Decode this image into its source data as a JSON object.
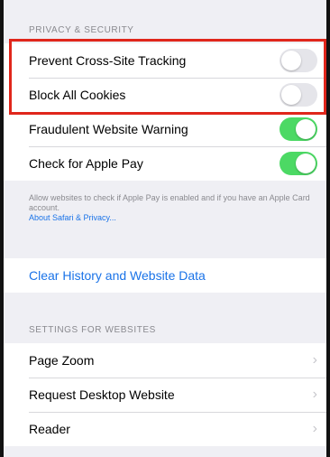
{
  "privacy_section": {
    "header": "PRIVACY & SECURITY",
    "rows": [
      {
        "label": "Prevent Cross-Site Tracking",
        "toggle": "off"
      },
      {
        "label": "Block All Cookies",
        "toggle": "off"
      },
      {
        "label": "Fraudulent Website Warning",
        "toggle": "on"
      },
      {
        "label": "Check for Apple Pay",
        "toggle": "on"
      }
    ],
    "footer": "Allow websites to check if Apple Pay is enabled and if you have an Apple Card account.",
    "footer_link": "About Safari & Privacy..."
  },
  "clear_history": {
    "label": "Clear History and Website Data"
  },
  "websites_section": {
    "header": "SETTINGS FOR WEBSITES",
    "rows": [
      {
        "label": "Page Zoom"
      },
      {
        "label": "Request Desktop Website"
      },
      {
        "label": "Reader"
      }
    ]
  },
  "colors": {
    "toggle_on": "#4cd964",
    "toggle_off": "#e5e5ea",
    "link": "#1a73e8",
    "highlight": "#e0261b"
  }
}
